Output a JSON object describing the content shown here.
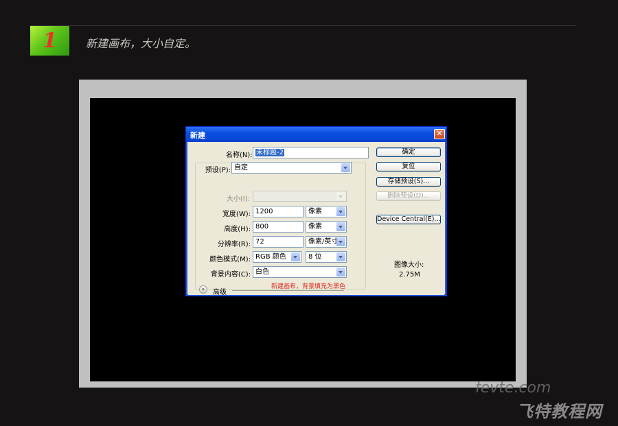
{
  "step": {
    "number": "1",
    "caption": "新建画布，大小自定。"
  },
  "dialog": {
    "title": "新建",
    "fields": {
      "name_label": "名称(N):",
      "name_value": "未标题-2",
      "preset_label": "预设(P):",
      "preset_value": "自定",
      "size_label": "大小(I):",
      "size_value": "",
      "width_label": "宽度(W):",
      "width_value": "1200",
      "width_unit": "像素",
      "height_label": "高度(H):",
      "height_value": "800",
      "height_unit": "像素",
      "resolution_label": "分辨率(R):",
      "resolution_value": "72",
      "resolution_unit": "像素/英寸",
      "color_mode_label": "颜色模式(M):",
      "color_mode_value": "RGB 颜色",
      "bit_depth_value": "8 位",
      "background_label": "背景内容(C):",
      "background_value": "白色",
      "advanced_label": "高级"
    },
    "annotation": "新建画布，背景填充为黑色",
    "buttons": {
      "ok": "确定",
      "reset": "复位",
      "save_preset": "存储预设(S)...",
      "delete_preset": "删除预设(D)...",
      "device_central": "Device Central(E)..."
    },
    "image_size_label": "图像大小:",
    "image_size_value": "2.75M"
  },
  "watermark": {
    "domain": "fevte.com",
    "site": "飞特教程网"
  }
}
